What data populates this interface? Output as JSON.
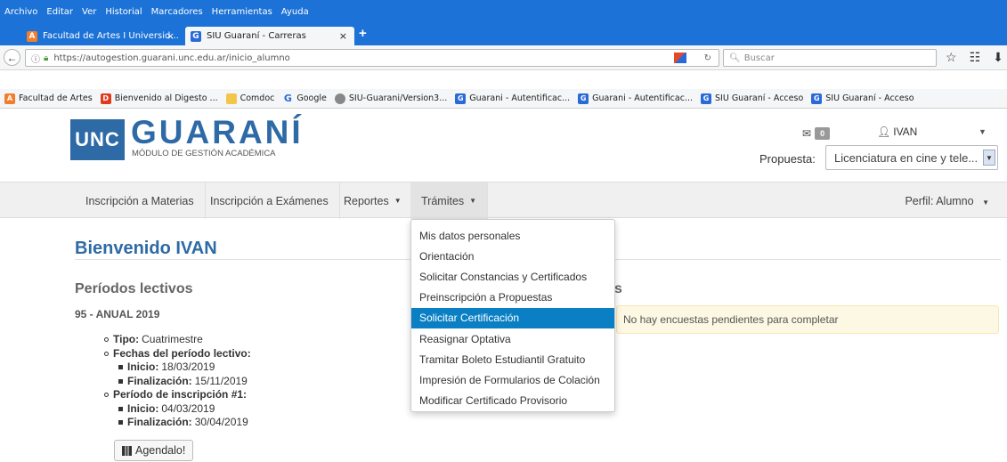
{
  "browser": {
    "menu": [
      "Archivo",
      "Editar",
      "Ver",
      "Historial",
      "Marcadores",
      "Herramientas",
      "Ayuda"
    ],
    "tabs": [
      {
        "title": "Facultad de Artes I Universid...",
        "close": "×"
      },
      {
        "title": "SIU Guaraní - Carreras",
        "close": "×"
      }
    ],
    "new_tab": "+",
    "url": "https://autogestion.guarani.unc.edu.ar/inicio_alumno",
    "search_placeholder": "Buscar",
    "bookmarks": [
      {
        "label": "Facultad de Artes",
        "icon": "artes-favicon"
      },
      {
        "label": "Bienvenido al Digesto ...",
        "icon": "digesto-favicon"
      },
      {
        "label": "Comdoc",
        "icon": "folder-icon"
      },
      {
        "label": "Google",
        "icon": "google-favicon"
      },
      {
        "label": "SIU-Guarani/Version3...",
        "icon": "globe-icon"
      },
      {
        "label": "Guarani - Autentificac...",
        "icon": "guarani-favicon"
      },
      {
        "label": "Guarani - Autentificac...",
        "icon": "guarani-favicon"
      },
      {
        "label": "SIU Guaraní - Acceso",
        "icon": "guarani-favicon"
      },
      {
        "label": "SIU Guaraní - Acceso",
        "icon": "guarani-favicon"
      }
    ]
  },
  "header": {
    "logo_unc": "UNC",
    "logo_name": "GUARANÍ",
    "logo_sub": "MÓDULO DE GESTIÓN ACADÉMICA",
    "messages_count": "0",
    "user_name": "IVAN",
    "propuesta_label": "Propuesta:",
    "propuesta_value": "Licenciatura en cine y tele..."
  },
  "nav": {
    "items": [
      "Inscripción a Materias",
      "Inscripción a Exámenes",
      "Reportes",
      "Trámites"
    ],
    "perfil": "Perfil: Alumno"
  },
  "dropdown": {
    "items": [
      "Mis datos personales",
      "Orientación",
      "Solicitar Constancias y Certificados",
      "Preinscripción a Propuestas",
      "Solicitar Certificación",
      "Reasignar Optativa",
      "Tramitar Boleto Estudiantil Gratuito",
      "Impresión de Formularios de Colación",
      "Modificar Certificado Provisorio"
    ],
    "highlighted_index": 4
  },
  "main": {
    "welcome": "Bienvenido IVAN",
    "periodos_title": "Períodos lectivos",
    "encuestas_title_tail": "s",
    "periodo_name": "95 - ANUAL 2019",
    "tipo_label": "Tipo:",
    "tipo_value": "Cuatrimestre",
    "fechas_label": "Fechas del período lectivo:",
    "inicio_label": "Inicio:",
    "inicio_value": "18/03/2019",
    "fin_label": "Finalización:",
    "fin_value": "15/11/2019",
    "insc_label": "Período de inscripción #1:",
    "insc_inicio_value": "04/03/2019",
    "insc_fin_value": "30/04/2019",
    "agendalo": "Agendalo!",
    "alert_text": "No hay encuestas pendientes para completar"
  }
}
